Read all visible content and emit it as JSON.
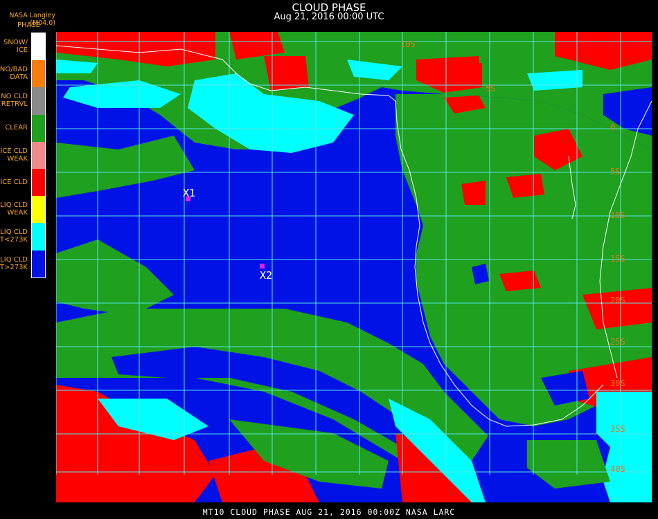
{
  "header": {
    "title": "CLOUD PHASE",
    "subtitle": "Aug 21, 2016 00:00 UTC",
    "agency": "NASA Langley (M04.0)",
    "legend_title": "PHASE"
  },
  "legend": [
    {
      "line1": "SNOW/",
      "line2": "ICE",
      "color": "#ffffff"
    },
    {
      "line1": "NO/BAD",
      "line2": "DATA",
      "color": "#f57f0a"
    },
    {
      "line1": "NO CLD",
      "line2": "RETRVL",
      "color": "#8a8a8a"
    },
    {
      "line1": "CLEAR",
      "line2": "",
      "color": "#1fa01f"
    },
    {
      "line1": "ICE CLD",
      "line2": "WEAK",
      "color": "#f08a8a"
    },
    {
      "line1": "ICE CLD",
      "line2": "",
      "color": "#ff0000"
    },
    {
      "line1": "LIQ CLD",
      "line2": "WEAK",
      "color": "#ffff00"
    },
    {
      "line1": "LIQ CLD",
      "line2": "T<273K",
      "color": "#00ffff"
    },
    {
      "line1": "LIQ CLD",
      "line2": "T>273K",
      "color": "#0012e6"
    }
  ],
  "map": {
    "grid_color": "#58e6e6",
    "coast_color": "#ffffff",
    "latitude_labels": [
      "10S",
      "5S",
      "0",
      "5S",
      "10S",
      "15S",
      "20S",
      "25S",
      "30S",
      "35S",
      "40S"
    ],
    "markers": [
      {
        "label": "X1",
        "color": "#e020e0"
      },
      {
        "label": "X2",
        "color": "#e020e0"
      }
    ]
  },
  "footer": {
    "text": "MT10   CLOUD PHASE   AUG 21, 2016 00:00Z   NASA LARC"
  }
}
